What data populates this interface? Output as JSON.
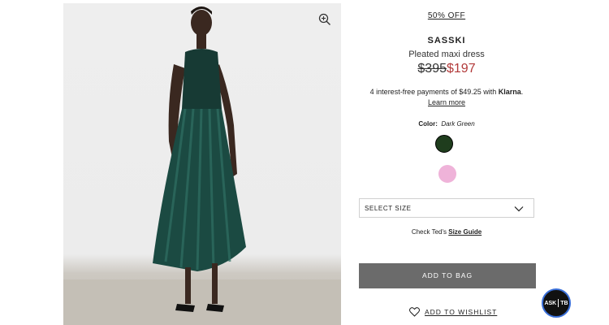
{
  "product": {
    "discount": "50% OFF",
    "name": "SASSKI",
    "subtitle": "Pleated maxi dress",
    "price_old": "$395",
    "price_new": "$197",
    "klarna_text": "4 interest-free payments of $49.25 with",
    "klarna_brand": "Klarna",
    "klarna_period": ".",
    "learn_more": "Learn more",
    "color_label": "Color:",
    "color_value": "Dark Green",
    "swatches": [
      {
        "name": "Dark Green",
        "hex": "#1f3d1d"
      },
      {
        "name": "Pink",
        "hex": "#efb3d9"
      }
    ],
    "size_select": "SELECT SIZE",
    "guide_prefix": "Check Ted's",
    "guide_link": "Size Guide",
    "add_to_bag": "ADD TO BAG",
    "wishlist": "ADD TO WISHLIST"
  },
  "ask": {
    "left": "ASK",
    "right": "TB"
  },
  "colors": {
    "accent_price": "#b23a3a",
    "button_bg": "#6b6b6b",
    "ask_ring": "#3a6fd8"
  },
  "icons": {
    "zoom": "zoom-in-icon",
    "chevron": "chevron-down-icon",
    "heart": "heart-icon"
  }
}
